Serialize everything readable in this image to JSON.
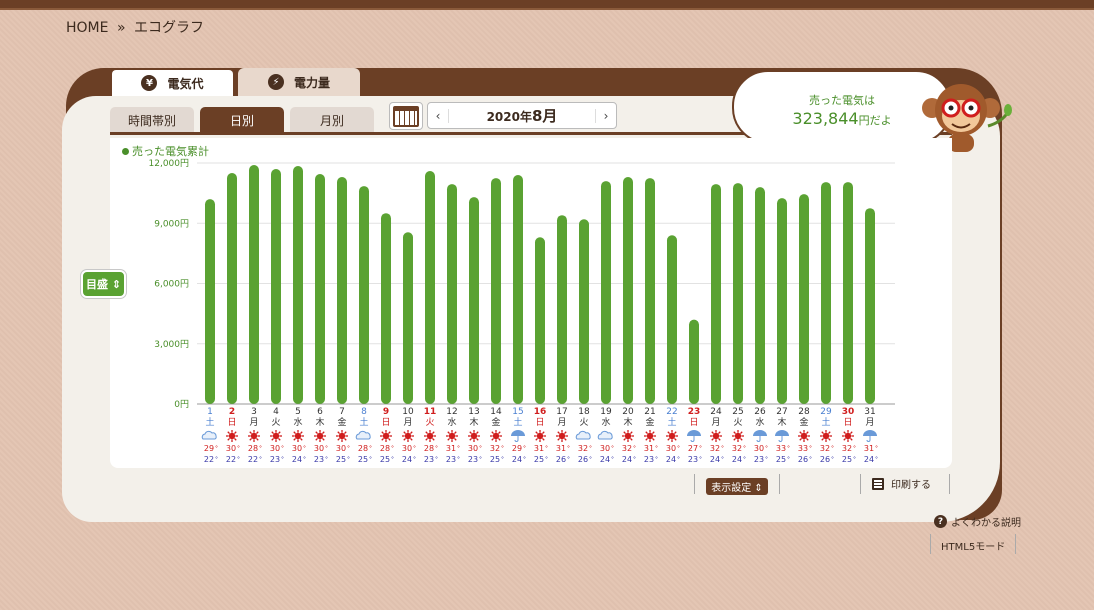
{
  "breadcrumb": {
    "home": "HOME",
    "sep": "»",
    "current": "エコグラフ"
  },
  "tabs_top": [
    {
      "label": "電気代",
      "icon": "¥"
    },
    {
      "label": "電力量",
      "icon": "⚡"
    }
  ],
  "tabs_sub": [
    {
      "label": "時間帯別"
    },
    {
      "label": "日別"
    },
    {
      "label": "月別"
    }
  ],
  "month_nav": {
    "prefix": "2020年",
    "month": "8月",
    "prev": "‹",
    "next": "›"
  },
  "bubble": {
    "line1": "売った電気は",
    "value": "323,844",
    "suffix": "円だよ"
  },
  "legend": {
    "label": "売った電気累計"
  },
  "meyasu": {
    "label": "目盛 ⇕"
  },
  "buttons": {
    "display_settings": "表示設定 ⇕",
    "print": "印刷する",
    "help": "よくわかる説明",
    "html5": "HTML5モード",
    "help_icon": "?"
  },
  "colors": {
    "bar": "#5aa232",
    "saturday": "#4a7fd0",
    "sunday": "#d01e1e",
    "high": "#d01e1e",
    "low": "#3a3aa8"
  },
  "chart_data": {
    "type": "bar",
    "categories": [
      "1",
      "2",
      "3",
      "4",
      "5",
      "6",
      "7",
      "8",
      "9",
      "10",
      "11",
      "12",
      "13",
      "14",
      "15",
      "16",
      "17",
      "18",
      "19",
      "20",
      "21",
      "22",
      "23",
      "24",
      "25",
      "26",
      "27",
      "28",
      "29",
      "30",
      "31"
    ],
    "weekdays": [
      "土",
      "日",
      "月",
      "火",
      "水",
      "木",
      "金",
      "土",
      "日",
      "月",
      "火",
      "水",
      "木",
      "金",
      "土",
      "日",
      "月",
      "火",
      "水",
      "木",
      "金",
      "土",
      "日",
      "月",
      "火",
      "水",
      "木",
      "金",
      "土",
      "日",
      "月"
    ],
    "day_types": [
      "sat",
      "sun",
      "wd",
      "wd",
      "wd",
      "wd",
      "wd",
      "sat",
      "sun",
      "wd",
      "hol",
      "wd",
      "wd",
      "wd",
      "sat",
      "sun",
      "wd",
      "wd",
      "wd",
      "wd",
      "wd",
      "sat",
      "sun",
      "wd",
      "wd",
      "wd",
      "wd",
      "wd",
      "sat",
      "sun",
      "wd"
    ],
    "values": [
      10200,
      11500,
      11900,
      11700,
      11850,
      11450,
      11300,
      10850,
      9500,
      8550,
      11600,
      10950,
      10300,
      11250,
      11400,
      8300,
      9400,
      9200,
      11100,
      11300,
      11250,
      8400,
      4200,
      10950,
      11000,
      10800,
      10250,
      10450,
      11050,
      11050,
      9750
    ],
    "weather": [
      "cloudy",
      "sunny",
      "sunny",
      "sunny",
      "sunny",
      "sunny",
      "sunny",
      "cloudy",
      "sunny",
      "sunny",
      "sunny",
      "sunny",
      "sunny",
      "sunny",
      "rain",
      "sunny",
      "sunny",
      "cloudy",
      "cloudy",
      "sunny",
      "sunny",
      "sunny",
      "rain",
      "sunny",
      "sunny",
      "rain",
      "rain",
      "sunny",
      "sunny",
      "sunny",
      "rain"
    ],
    "temp_high": [
      29,
      30,
      28,
      30,
      30,
      30,
      30,
      28,
      28,
      30,
      28,
      31,
      30,
      32,
      29,
      31,
      31,
      32,
      30,
      32,
      31,
      30,
      27,
      32,
      32,
      30,
      33,
      33,
      32,
      32,
      31
    ],
    "temp_low": [
      22,
      22,
      22,
      23,
      24,
      23,
      25,
      25,
      25,
      24,
      23,
      23,
      23,
      25,
      24,
      25,
      26,
      26,
      24,
      24,
      23,
      24,
      23,
      24,
      24,
      23,
      25,
      26,
      26,
      25,
      24
    ],
    "y_ticks": [
      "0円",
      "3,000円",
      "6,000円",
      "9,000円",
      "12,000円"
    ],
    "ylim": [
      0,
      12000
    ]
  }
}
